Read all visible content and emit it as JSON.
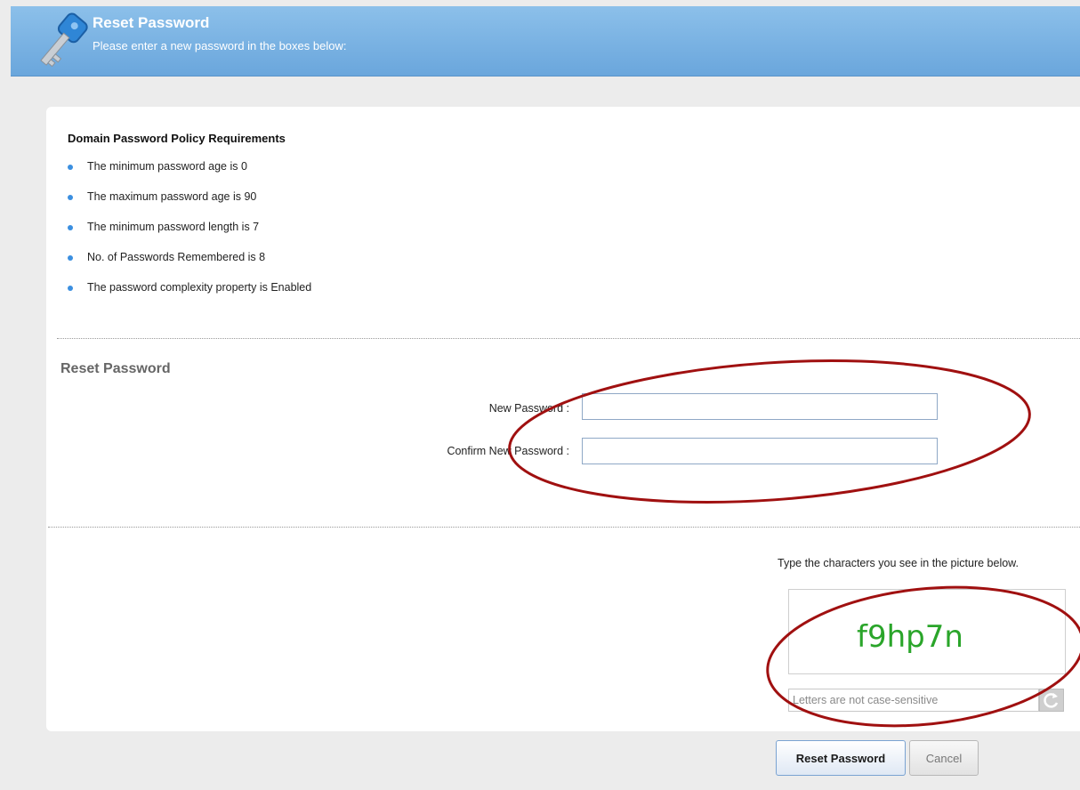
{
  "header": {
    "title": "Reset Password",
    "subtitle": "Please enter a new password in the boxes below:",
    "icon": "key-icon"
  },
  "policy": {
    "title": "Domain Password Policy Requirements",
    "items": [
      "The minimum password age is 0",
      "The maximum password age is 90",
      "The minimum password length is 7",
      "No. of Passwords Remembered is 8",
      "The password complexity property is Enabled"
    ]
  },
  "reset_section": {
    "title": "Reset Password",
    "new_password_label": "New Password :",
    "new_password_value": "",
    "confirm_password_label": "Confirm New Password :",
    "confirm_password_value": ""
  },
  "captcha": {
    "prompt": "Type the characters you see in the picture below.",
    "image_text": "f9hp7n",
    "input_placeholder": "Letters are not case-sensitive",
    "refresh_icon": "refresh-icon"
  },
  "buttons": {
    "reset_label": "Reset Password",
    "cancel_label": "Cancel"
  },
  "colors": {
    "header_blue": "#7ab2e3",
    "accent_bullet": "#3b8fe0",
    "annotation_red": "#a01010",
    "captcha_green": "#2aa52a"
  }
}
